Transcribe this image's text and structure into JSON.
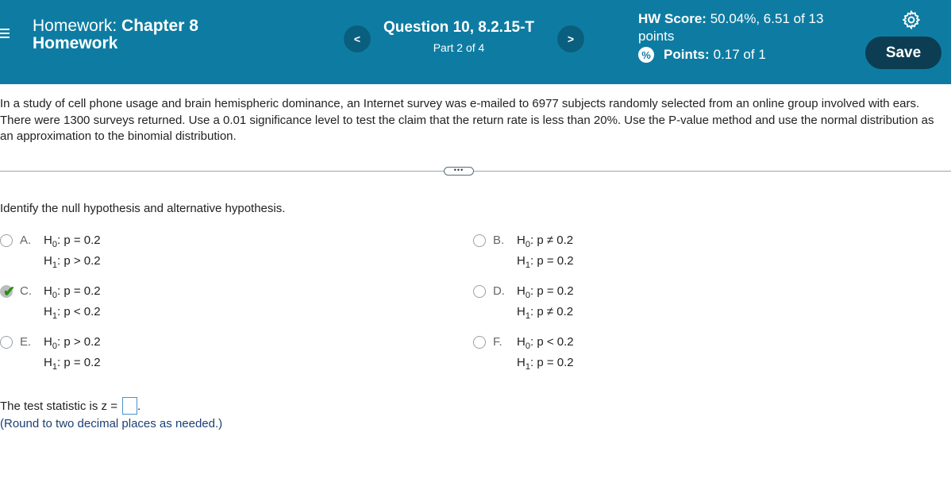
{
  "header": {
    "hw_label": "Homework:",
    "hw_title_bold_1": "Chapter 8",
    "hw_title_bold_2": "Homework",
    "question_title": "Question 10, 8.2.15-T",
    "question_part": "Part 2 of 4",
    "prev_label": "<",
    "next_label": ">",
    "hw_score_label": "HW Score:",
    "hw_score_value": "50.04%, 6.51 of 13",
    "hw_score_unit": "points",
    "points_label": "Points:",
    "points_value": "0.17 of 1",
    "save_label": "Save"
  },
  "problem": {
    "text": "In a study of cell phone usage and brain hemispheric dominance, an Internet survey was e-mailed to 6977 subjects randomly selected from an online group involved with ears. There were 1300 surveys returned. Use a 0.01 significance level to test the claim that the return rate is less than 20%. Use the P-value method and use the normal distribution as an approximation to the binomial distribution.",
    "expand_label": "•••"
  },
  "question": {
    "prompt": "Identify the null hypothesis and alternative hypothesis.",
    "selected": "C",
    "options": [
      {
        "letter": "A.",
        "h0": "p = 0.2",
        "h1": "p > 0.2"
      },
      {
        "letter": "B.",
        "h0": "p ≠ 0.2",
        "h1": "p = 0.2"
      },
      {
        "letter": "C.",
        "h0": "p = 0.2",
        "h1": "p < 0.2"
      },
      {
        "letter": "D.",
        "h0": "p = 0.2",
        "h1": "p ≠ 0.2"
      },
      {
        "letter": "E.",
        "h0": "p > 0.2",
        "h1": "p = 0.2"
      },
      {
        "letter": "F.",
        "h0": "p < 0.2",
        "h1": "p = 0.2"
      }
    ],
    "h0_sym": "H",
    "h0_sub": "0",
    "h1_sub": "1",
    "colon": ":"
  },
  "answer": {
    "test_stat_label": "The test statistic is z =",
    "period": ".",
    "round_note": "(Round to two decimal places as needed.)"
  },
  "colors": {
    "header_bg": "#0e7ca2",
    "save_bg": "#0c3d52",
    "correct_check": "#2f8a17",
    "note_text": "#1b3f73"
  },
  "icons": {
    "menu": "hamburger-icon",
    "settings": "gear-icon",
    "points": "partial-credit-icon",
    "correct": "checkmark-icon"
  }
}
